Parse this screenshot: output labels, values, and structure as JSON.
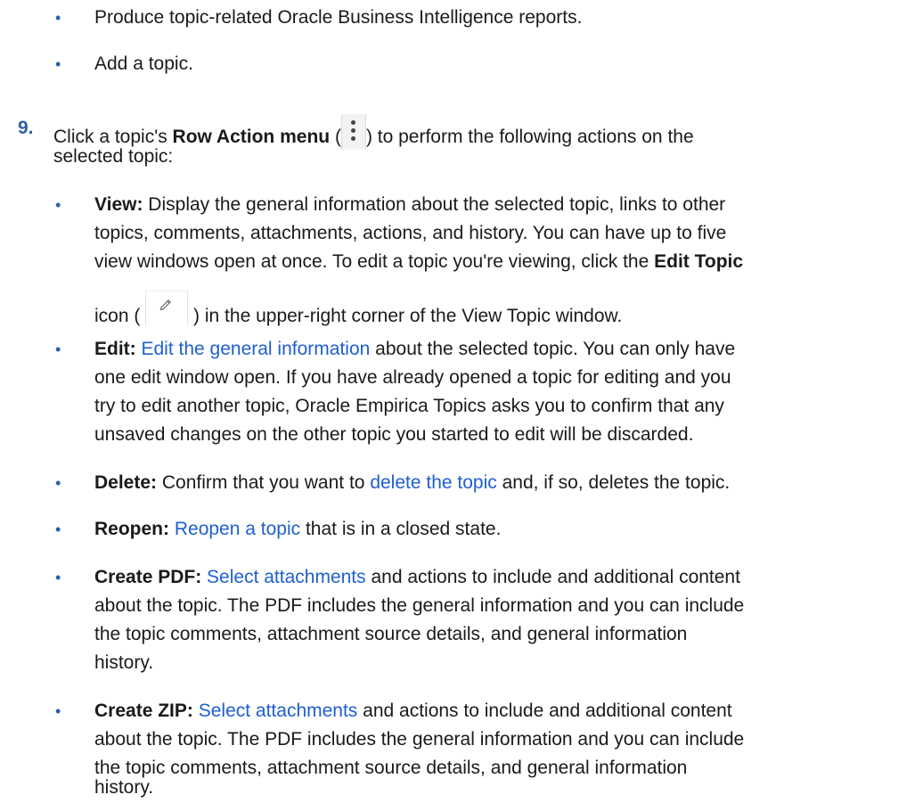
{
  "bullets_top": [
    {
      "text": "Produce topic-related Oracle Business Intelligence reports."
    },
    {
      "text": "Add a topic."
    }
  ],
  "step": {
    "number": "9.",
    "prefix": "Click a topic's ",
    "menu_label": "Row Action menu",
    "open_paren": " (",
    "suffix_line1": ") to perform the following actions on the",
    "line2": "selected topic:"
  },
  "actions": {
    "view": {
      "label": "View:",
      "l1": " Display the general information about the selected topic, links to other",
      "l2": "topics, comments, attachments, actions, and history. You can have up to five",
      "l3": "view windows open at once. To edit a topic you're viewing, click the ",
      "edit_topic": "Edit Topic",
      "l4a": "icon (",
      "l4b": ") in the upper-right corner of the View Topic window."
    },
    "edit": {
      "label": "Edit:",
      "link": "Edit the general information",
      "l1": " about the selected topic. You can only have",
      "l2": "one edit window open. If you have already opened a topic for editing and you",
      "l3": "try to edit another topic, Oracle Empirica Topics asks you to confirm that any",
      "l4": "unsaved changes on the other topic you started to edit will be discarded."
    },
    "delete": {
      "label": "Delete:",
      "t1": " Confirm that you want to ",
      "link": "delete the topic",
      "t2": " and, if so, deletes the topic."
    },
    "reopen": {
      "label": "Reopen:",
      "link": "Reopen a topic",
      "t1": " that is in a closed state."
    },
    "pdf": {
      "label": "Create PDF:",
      "link": "Select attachments",
      "l1": " and actions to include and additional content",
      "l2": "about the topic. The PDF includes the general information and you can include",
      "l3": "the topic comments, attachment source details, and general information",
      "l4": "history."
    },
    "zip": {
      "label": "Create ZIP:",
      "link": "Select attachments",
      "l1": " and actions to include and additional content",
      "l2": "about the topic. The PDF includes the general information and you can include",
      "l3": "the topic comments, attachment source details, and general information",
      "l4": "history."
    }
  },
  "icons": {
    "row_action": "kebab-vertical-icon",
    "edit_topic": "pencil-icon"
  },
  "colors": {
    "bullet": "#2b5fa8",
    "link": "#1f5fd0",
    "text": "#1a1a1a"
  }
}
